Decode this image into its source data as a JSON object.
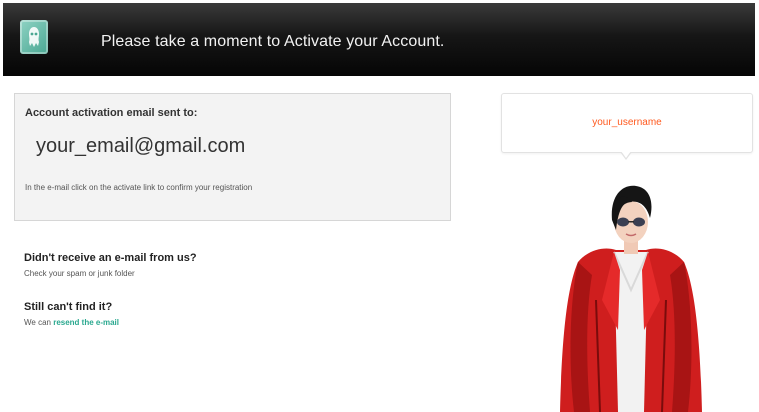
{
  "header": {
    "title": "Please take a moment to Activate your Account."
  },
  "activation": {
    "sent_label": "Account activation email sent to:",
    "email": "your_email@gmail.com",
    "hint": "In the e-mail click on the activate link to confirm your registration"
  },
  "help": {
    "q1_heading": "Didn't receive an e-mail from us?",
    "q1_text": "Check your spam or junk folder",
    "q2_heading": "Still can't find it?",
    "q2_prefix": "We can ",
    "q2_link": "resend the e-mail"
  },
  "profile": {
    "username": "your_username"
  },
  "colors": {
    "username": "#ff5a1f",
    "link": "#2aa88f",
    "avatar_jacket": "#d11d1d"
  },
  "icons": {
    "logo": "app-logo-icon"
  }
}
